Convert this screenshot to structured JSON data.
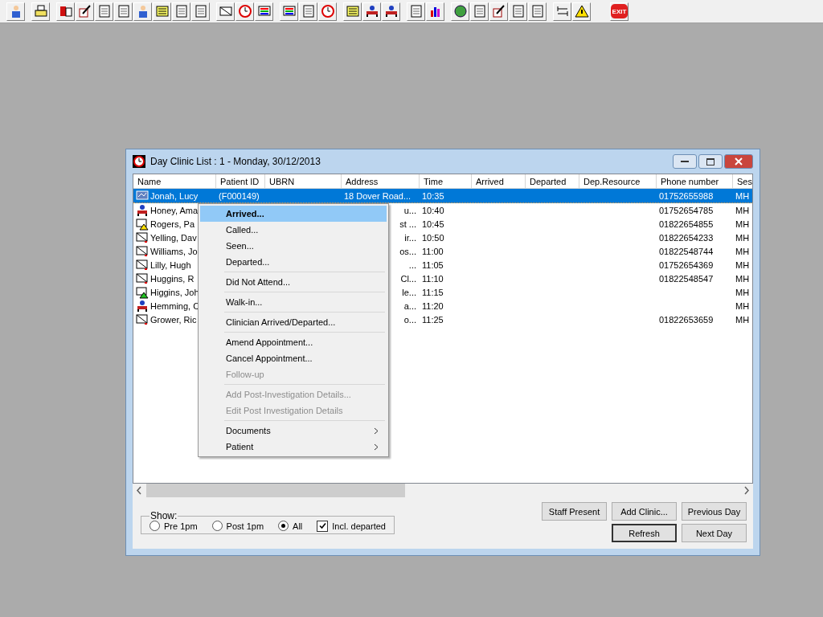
{
  "toolbar": {
    "exit_label": "EXIT"
  },
  "window": {
    "title": "Day Clinic List : 1 - Monday, 30/12/2013"
  },
  "table": {
    "columns": [
      "Name",
      "Patient ID",
      "UBRN",
      "Address",
      "Time",
      "Arrived",
      "Departed",
      "Dep.Resource",
      "Phone number",
      "Ses"
    ],
    "rows": [
      {
        "kind": "chart",
        "selected": true,
        "name": "Jonah, Lucy",
        "patient_id": "(F000149)",
        "address": "18 Dover Road...",
        "time": "10:35",
        "phone": "01752655988",
        "session": "MH"
      },
      {
        "kind": "arrived",
        "selected": false,
        "name": "Honey, Ama",
        "address": "u...",
        "time": "10:40",
        "phone": "01752654785",
        "session": "MH"
      },
      {
        "kind": "warning",
        "selected": false,
        "name": "Rogers, Pa",
        "address": "st ...",
        "time": "10:45",
        "phone": "01822654855",
        "session": "MH"
      },
      {
        "kind": "letter",
        "selected": false,
        "name": "Yelling, Dav",
        "address": "ir...",
        "time": "10:50",
        "phone": "01822654233",
        "session": "MH"
      },
      {
        "kind": "letter",
        "selected": false,
        "name": "Williams, Jo",
        "address": "os...",
        "time": "11:00",
        "phone": "01822548744",
        "session": "MH"
      },
      {
        "kind": "letter",
        "selected": false,
        "name": "Lilly, Hugh",
        "address": "...",
        "time": "11:05",
        "phone": "01752654369",
        "session": "MH"
      },
      {
        "kind": "letter",
        "selected": false,
        "name": "Huggins, R",
        "address": "Cl...",
        "time": "11:10",
        "phone": "01822548547",
        "session": "MH"
      },
      {
        "kind": "alert",
        "selected": false,
        "name": "Higgins, Joh",
        "address": "le...",
        "time": "11:15",
        "session": "MH"
      },
      {
        "kind": "arrived",
        "selected": false,
        "name": "Hemming, C",
        "address": "a...",
        "time": "11:20",
        "session": "MH"
      },
      {
        "kind": "letter",
        "selected": false,
        "name": "Grower, Ric",
        "address": "o...",
        "time": "11:25",
        "phone": "01822653659",
        "session": "MH"
      }
    ]
  },
  "context_menu": {
    "groups": [
      [
        {
          "label": "Arrived...",
          "selected": true,
          "default": true,
          "disabled": false,
          "submenu": false
        },
        {
          "label": "Called...",
          "selected": false,
          "default": false,
          "disabled": false,
          "submenu": false
        },
        {
          "label": "Seen...",
          "selected": false,
          "default": false,
          "disabled": false,
          "submenu": false
        },
        {
          "label": "Departed...",
          "selected": false,
          "default": false,
          "disabled": false,
          "submenu": false
        }
      ],
      [
        {
          "label": "Did Not Attend...",
          "selected": false,
          "default": false,
          "disabled": false,
          "submenu": false
        }
      ],
      [
        {
          "label": "Walk-in...",
          "selected": false,
          "default": false,
          "disabled": false,
          "submenu": false
        }
      ],
      [
        {
          "label": "Clinician Arrived/Departed...",
          "selected": false,
          "default": false,
          "disabled": false,
          "submenu": false
        }
      ],
      [
        {
          "label": "Amend Appointment...",
          "selected": false,
          "default": false,
          "disabled": false,
          "submenu": false
        },
        {
          "label": "Cancel Appointment...",
          "selected": false,
          "default": false,
          "disabled": false,
          "submenu": false
        },
        {
          "label": "Follow-up",
          "selected": false,
          "default": false,
          "disabled": true,
          "submenu": false
        }
      ],
      [
        {
          "label": "Add Post-Investigation Details...",
          "selected": false,
          "default": false,
          "disabled": true,
          "submenu": false
        },
        {
          "label": "Edit Post Investigation Details",
          "selected": false,
          "default": false,
          "disabled": true,
          "submenu": false
        }
      ],
      [
        {
          "label": "Documents",
          "selected": false,
          "default": false,
          "disabled": false,
          "submenu": true
        },
        {
          "label": "Patient",
          "selected": false,
          "default": false,
          "disabled": false,
          "submenu": true
        }
      ]
    ]
  },
  "show": {
    "legend": "Show:",
    "options": [
      {
        "kind": "radio",
        "label": "Pre 1pm",
        "selected": false
      },
      {
        "kind": "radio",
        "label": "Post 1pm",
        "selected": false
      },
      {
        "kind": "radio",
        "label": "All",
        "selected": true
      },
      {
        "kind": "checkbox",
        "label": "Incl. departed",
        "checked": true
      }
    ]
  },
  "buttons": [
    [
      {
        "label": "Staff Present",
        "default": false
      },
      {
        "label": "Add Clinic...",
        "default": false
      },
      {
        "label": "Previous Day",
        "default": false
      }
    ],
    [
      {
        "label": "Refresh",
        "default": true
      },
      {
        "label": "Next Day",
        "default": false
      }
    ]
  ]
}
